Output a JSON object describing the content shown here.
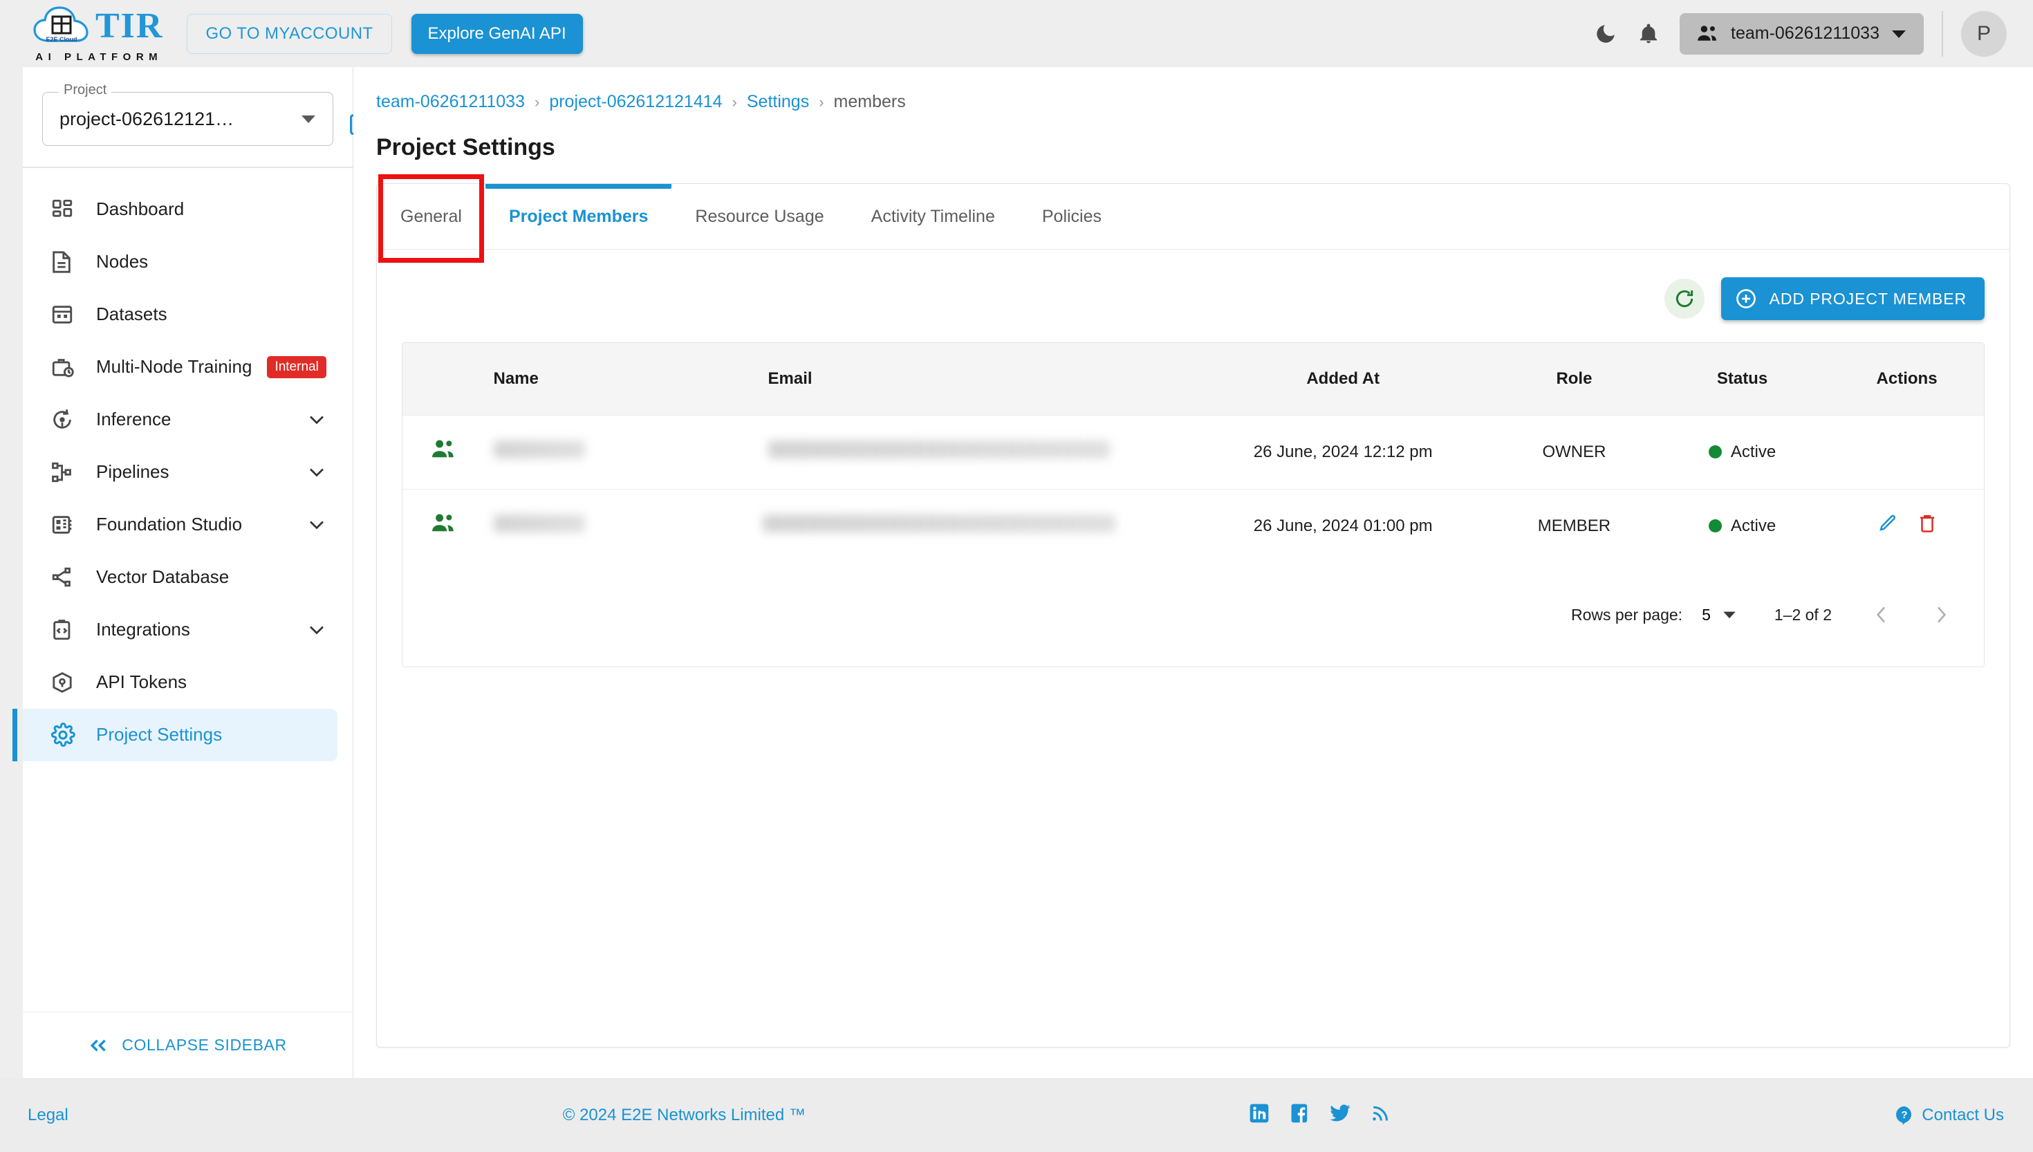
{
  "topbar": {
    "logo_title": "TIR",
    "logo_subtitle": "AI PLATFORM",
    "logo_cloud_text": "E2E Cloud",
    "myaccount_label": "GO TO MYACCOUNT",
    "genai_label": "Explore GenAI API",
    "team_name": "team-06261211033",
    "avatar_initial": "P"
  },
  "sidebar": {
    "project_label": "Project",
    "project_value": "project-062612121…",
    "items": [
      {
        "label": "Dashboard",
        "icon": "dashboard-icon",
        "chevron": false,
        "badge": null,
        "active": false
      },
      {
        "label": "Nodes",
        "icon": "document-icon",
        "chevron": false,
        "badge": null,
        "active": false
      },
      {
        "label": "Datasets",
        "icon": "grid-icon",
        "chevron": false,
        "badge": null,
        "active": false
      },
      {
        "label": "Multi-Node Training",
        "icon": "briefcase-clock-icon",
        "chevron": false,
        "badge": "Internal",
        "active": false
      },
      {
        "label": "Inference",
        "icon": "inference-icon",
        "chevron": true,
        "badge": null,
        "active": false
      },
      {
        "label": "Pipelines",
        "icon": "pipelines-icon",
        "chevron": true,
        "badge": null,
        "active": false
      },
      {
        "label": "Foundation Studio",
        "icon": "studio-icon",
        "chevron": true,
        "badge": null,
        "active": false
      },
      {
        "label": "Vector Database",
        "icon": "vector-db-icon",
        "chevron": false,
        "badge": null,
        "active": false
      },
      {
        "label": "Integrations",
        "icon": "code-clipboard-icon",
        "chevron": true,
        "badge": null,
        "active": false
      },
      {
        "label": "API Tokens",
        "icon": "token-cube-icon",
        "chevron": false,
        "badge": null,
        "active": false
      },
      {
        "label": "Project Settings",
        "icon": "gear-icon",
        "chevron": false,
        "badge": null,
        "active": true
      }
    ],
    "collapse_label": "COLLAPSE SIDEBAR"
  },
  "breadcrumb": {
    "items": [
      "team-06261211033",
      "project-062612121414",
      "Settings",
      "members"
    ],
    "separator": "›"
  },
  "page": {
    "title": "Project Settings"
  },
  "tabs": [
    {
      "label": "General",
      "active": false,
      "highlighted": true
    },
    {
      "label": "Project Members",
      "active": true,
      "highlighted": false
    },
    {
      "label": "Resource Usage",
      "active": false,
      "highlighted": false
    },
    {
      "label": "Activity Timeline",
      "active": false,
      "highlighted": false
    },
    {
      "label": "Policies",
      "active": false,
      "highlighted": false
    }
  ],
  "toolbar": {
    "refresh_label": "refresh-icon",
    "add_member_label": "ADD PROJECT MEMBER"
  },
  "table": {
    "columns": [
      "",
      "Name",
      "Email",
      "Added At",
      "Role",
      "Status",
      "Actions"
    ],
    "rows": [
      {
        "name": "",
        "name_redacted": true,
        "email": "",
        "email_redacted": true,
        "added_at": "26 June, 2024 12:12 pm",
        "role": "OWNER",
        "status": "Active",
        "status_color": "#138a36",
        "has_actions": false
      },
      {
        "name": "",
        "name_redacted": true,
        "email": "",
        "email_redacted": true,
        "added_at": "26 June, 2024 01:00 pm",
        "role": "MEMBER",
        "status": "Active",
        "status_color": "#138a36",
        "has_actions": true
      }
    ]
  },
  "pagination": {
    "rows_per_page_label": "Rows per page:",
    "rows_per_page_value": "5",
    "range_label": "1–2 of 2"
  },
  "footer": {
    "legal": "Legal",
    "copyright": "© 2024 E2E Networks Limited ™",
    "contact": "Contact Us",
    "social": [
      "linkedin-icon",
      "facebook-icon",
      "twitter-icon",
      "rss-icon"
    ]
  },
  "colors": {
    "accent": "#1a92d3",
    "highlight_box": "#ee1111",
    "badge_red": "#e02b27",
    "status_green": "#138a36"
  }
}
